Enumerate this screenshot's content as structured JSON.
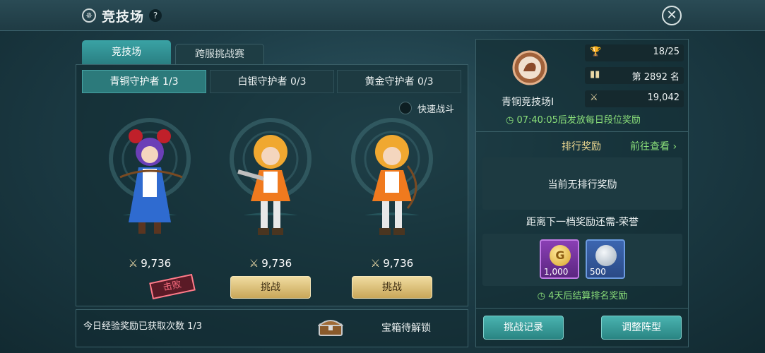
{
  "header": {
    "title": "竞技场",
    "help": "?",
    "close": "✕"
  },
  "tabs": [
    {
      "label": "竞技场",
      "active": true
    },
    {
      "label": "跨服挑战赛",
      "active": false
    }
  ],
  "subtabs": [
    {
      "label": "青铜守护者 1/3",
      "active": true
    },
    {
      "label": "白银守护者 0/3",
      "active": false
    },
    {
      "label": "黄金守护者 0/3",
      "active": false
    }
  ],
  "quick_battle": {
    "label": "快速战斗",
    "enabled": false
  },
  "opponents": [
    {
      "power": "9,736",
      "status": "defeated",
      "status_label": "击败"
    },
    {
      "power": "9,736",
      "status": "challenge",
      "button_label": "挑战"
    },
    {
      "power": "9,736",
      "status": "challenge",
      "button_label": "挑战"
    }
  ],
  "footer": {
    "exp_text": "今日经验奖励已获取次数 1/3",
    "chest_text": "宝箱待解锁"
  },
  "rank": {
    "name": "青铜竞技场Ⅰ",
    "stats": [
      {
        "icon": "trophy-icon",
        "value": "18/25"
      },
      {
        "icon": "bar-chart-icon",
        "value": "第 2892 名"
      },
      {
        "icon": "crossed-swords-icon",
        "value": "19,042"
      }
    ],
    "timer": "07:40:05后发放每日段位奖励"
  },
  "rewards": {
    "heading": "排行奖励",
    "link": "前往查看",
    "no_reward": "当前无排行奖励",
    "next_tier": "距离下一档奖励还需-荣誉",
    "items": [
      {
        "icon": "gold-coin-icon",
        "count": "1,000",
        "rarity_color": "#8a3fb5"
      },
      {
        "icon": "silver-coin-icon",
        "count": "500",
        "rarity_color": "#3c66b0"
      }
    ],
    "settle": "4天后结算排名奖励"
  },
  "actions": {
    "records": "挑战记录",
    "lineup": "调整阵型"
  }
}
